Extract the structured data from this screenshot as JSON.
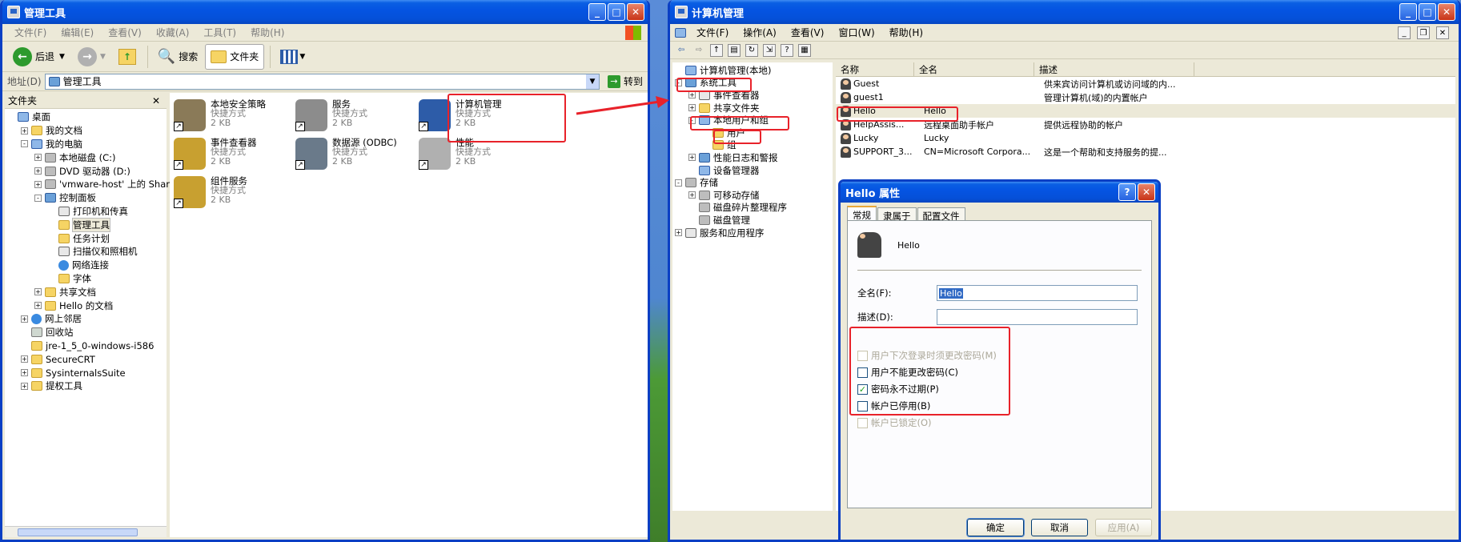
{
  "explorer": {
    "title": "管理工具",
    "menu": [
      "文件(F)",
      "编辑(E)",
      "查看(V)",
      "收藏(A)",
      "工具(T)",
      "帮助(H)"
    ],
    "toolbar": {
      "back": "后退",
      "search": "搜索",
      "folders": "文件夹"
    },
    "address_label": "地址(D)",
    "address_value": "管理工具",
    "go_label": "转到",
    "folders_title": "文件夹",
    "tree": [
      {
        "label": "桌面",
        "indent": 0,
        "exp": "",
        "icon": "desktop"
      },
      {
        "label": "我的文档",
        "indent": 1,
        "exp": "+",
        "icon": "folder"
      },
      {
        "label": "我的电脑",
        "indent": 1,
        "exp": "-",
        "icon": "computer"
      },
      {
        "label": "本地磁盘 (C:)",
        "indent": 2,
        "exp": "+",
        "icon": "drive"
      },
      {
        "label": "DVD 驱动器 (D:)",
        "indent": 2,
        "exp": "+",
        "icon": "drive"
      },
      {
        "label": "'vmware-host' 上的 Shar",
        "indent": 2,
        "exp": "+",
        "icon": "drive"
      },
      {
        "label": "控制面板",
        "indent": 2,
        "exp": "-",
        "icon": "control-panel"
      },
      {
        "label": "打印机和传真",
        "indent": 3,
        "exp": "",
        "icon": "printer"
      },
      {
        "label": "管理工具",
        "indent": 3,
        "exp": "",
        "icon": "folder",
        "selected": true
      },
      {
        "label": "任务计划",
        "indent": 3,
        "exp": "",
        "icon": "folder"
      },
      {
        "label": "扫描仪和照相机",
        "indent": 3,
        "exp": "",
        "icon": "printer"
      },
      {
        "label": "网络连接",
        "indent": 3,
        "exp": "",
        "icon": "globe"
      },
      {
        "label": "字体",
        "indent": 3,
        "exp": "",
        "icon": "folder"
      },
      {
        "label": "共享文档",
        "indent": 2,
        "exp": "+",
        "icon": "folder"
      },
      {
        "label": "Hello 的文档",
        "indent": 2,
        "exp": "+",
        "icon": "folder"
      },
      {
        "label": "网上邻居",
        "indent": 1,
        "exp": "+",
        "icon": "globe"
      },
      {
        "label": "回收站",
        "indent": 1,
        "exp": "",
        "icon": "trash"
      },
      {
        "label": "jre-1_5_0-windows-i586",
        "indent": 1,
        "exp": "",
        "icon": "folder"
      },
      {
        "label": "SecureCRT",
        "indent": 1,
        "exp": "+",
        "icon": "folder"
      },
      {
        "label": "SysinternalsSuite",
        "indent": 1,
        "exp": "+",
        "icon": "folder"
      },
      {
        "label": "提权工具",
        "indent": 1,
        "exp": "+",
        "icon": "folder"
      }
    ],
    "items": [
      {
        "name": "本地安全策略",
        "type": "快捷方式",
        "size": "2 KB",
        "icon": "policy"
      },
      {
        "name": "服务",
        "type": "快捷方式",
        "size": "2 KB",
        "icon": "gears"
      },
      {
        "name": "计算机管理",
        "type": "快捷方式",
        "size": "2 KB",
        "icon": "computer-management"
      },
      {
        "name": "事件查看器",
        "type": "快捷方式",
        "size": "2 KB",
        "icon": "event-viewer"
      },
      {
        "name": "数据源 (ODBC)",
        "type": "快捷方式",
        "size": "2 KB",
        "icon": "database"
      },
      {
        "name": "性能",
        "type": "快捷方式",
        "size": "2 KB",
        "icon": "performance"
      },
      {
        "name": "组件服务",
        "type": "快捷方式",
        "size": "2 KB",
        "icon": "component"
      }
    ]
  },
  "mmc": {
    "title": "计算机管理",
    "menu": [
      "文件(F)",
      "操作(A)",
      "查看(V)",
      "窗口(W)",
      "帮助(H)"
    ],
    "tree": [
      {
        "label": "计算机管理(本地)",
        "indent": 0,
        "exp": "",
        "icon": "computer"
      },
      {
        "label": "系统工具",
        "indent": 0,
        "exp": "-",
        "icon": "tools"
      },
      {
        "label": "事件查看器",
        "indent": 1,
        "exp": "+",
        "icon": "event-viewer"
      },
      {
        "label": "共享文件夹",
        "indent": 1,
        "exp": "+",
        "icon": "folder"
      },
      {
        "label": "本地用户和组",
        "indent": 1,
        "exp": "-",
        "icon": "users"
      },
      {
        "label": "用户",
        "indent": 2,
        "exp": "",
        "icon": "folder"
      },
      {
        "label": "组",
        "indent": 2,
        "exp": "",
        "icon": "folder"
      },
      {
        "label": "性能日志和警报",
        "indent": 1,
        "exp": "+",
        "icon": "performance"
      },
      {
        "label": "设备管理器",
        "indent": 1,
        "exp": "",
        "icon": "computer"
      },
      {
        "label": "存储",
        "indent": 0,
        "exp": "-",
        "icon": "drive"
      },
      {
        "label": "可移动存储",
        "indent": 1,
        "exp": "+",
        "icon": "drive"
      },
      {
        "label": "磁盘碎片整理程序",
        "indent": 1,
        "exp": "",
        "icon": "drive"
      },
      {
        "label": "磁盘管理",
        "indent": 1,
        "exp": "",
        "icon": "drive"
      },
      {
        "label": "服务和应用程序",
        "indent": 0,
        "exp": "+",
        "icon": "gears"
      }
    ],
    "columns": [
      "名称",
      "全名",
      "描述"
    ],
    "users": [
      {
        "name": "Guest",
        "full": "",
        "desc": "供来宾访问计算机或访问域的内..."
      },
      {
        "name": "guest1",
        "full": "",
        "desc": "管理计算机(域)的内置帐户"
      },
      {
        "name": "Hello",
        "full": "Hello",
        "desc": ""
      },
      {
        "name": "HelpAssis...",
        "full": "远程桌面助手帐户",
        "desc": "提供远程协助的帐户"
      },
      {
        "name": "Lucky",
        "full": "Lucky",
        "desc": ""
      },
      {
        "name": "SUPPORT_3...",
        "full": "CN=Microsoft Corpora...",
        "desc": "这是一个帮助和支持服务的提..."
      }
    ]
  },
  "dialog": {
    "title": "Hello 属性",
    "tabs": [
      "常规",
      "隶属于",
      "配置文件"
    ],
    "username": "Hello",
    "fullname_label": "全名(F):",
    "fullname_value": "Hello",
    "desc_label": "描述(D):",
    "desc_value": "",
    "checks": [
      {
        "label": "用户下次登录时须更改密码(M)",
        "checked": false,
        "disabled": true
      },
      {
        "label": "用户不能更改密码(C)",
        "checked": false,
        "disabled": false
      },
      {
        "label": "密码永不过期(P)",
        "checked": true,
        "disabled": false
      },
      {
        "label": "帐户已停用(B)",
        "checked": false,
        "disabled": false
      },
      {
        "label": "帐户已锁定(O)",
        "checked": false,
        "disabled": true
      }
    ],
    "ok": "确定",
    "cancel": "取消",
    "apply": "应用(A)"
  },
  "colors": {
    "annotation": "#e8222a",
    "titlebar": "#0554e2",
    "selection": "#316ac5"
  }
}
